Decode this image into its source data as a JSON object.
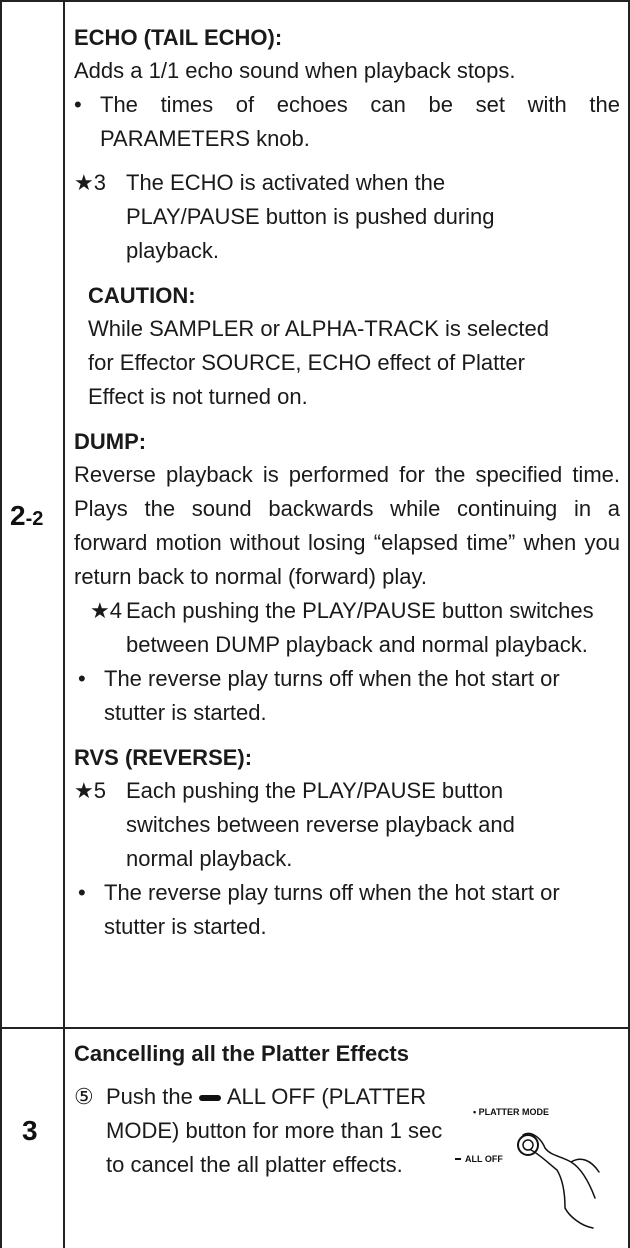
{
  "rows": [
    {
      "step": "2",
      "step_sub": "-2",
      "echo": {
        "heading": "ECHO (TAIL ECHO):",
        "desc": "Adds a 1/1 echo sound when playback stops.",
        "bullet_mark": "•",
        "bullet": "The times of echoes can be set with the PARAMETERS knob.",
        "star_mark": "★3",
        "star": "The ECHO is activated when the PLAY/PAUSE button is pushed during playback.",
        "caution_heading": "CAUTION:",
        "caution_text": "While SAMPLER or ALPHA-TRACK is selected for Effector SOURCE, ECHO effect of Platter Effect is not turned on."
      },
      "dump": {
        "heading": "DUMP:",
        "desc": "Reverse playback is performed for the specified time. Plays the sound backwards while continuing in a forward motion without losing “elapsed time” when you return back to normal (forward) play.",
        "star_mark": "★4",
        "star": "Each pushing the PLAY/PAUSE button switches between DUMP playback and normal playback.",
        "bullet_mark": "•",
        "bullet": "The reverse play turns off when the hot start or stutter is started."
      },
      "rvs": {
        "heading": "RVS (REVERSE):",
        "star_mark": "★5",
        "star": "Each pushing the PLAY/PAUSE button switches between reverse playback and normal playback.",
        "bullet_mark": "•",
        "bullet": "The reverse play turns off when the hot start or stutter is started."
      }
    },
    {
      "step": "3",
      "heading": "Cancelling all the Platter Effects",
      "item_mark": "⑤",
      "item_before": "Push the",
      "item_after": "ALL OFF (PLATTER MODE) button for more than 1 sec to cancel the all platter effects.",
      "illustration": {
        "label_top": "• PLATTER MODE",
        "label_bottom": "ALL OFF"
      }
    }
  ]
}
